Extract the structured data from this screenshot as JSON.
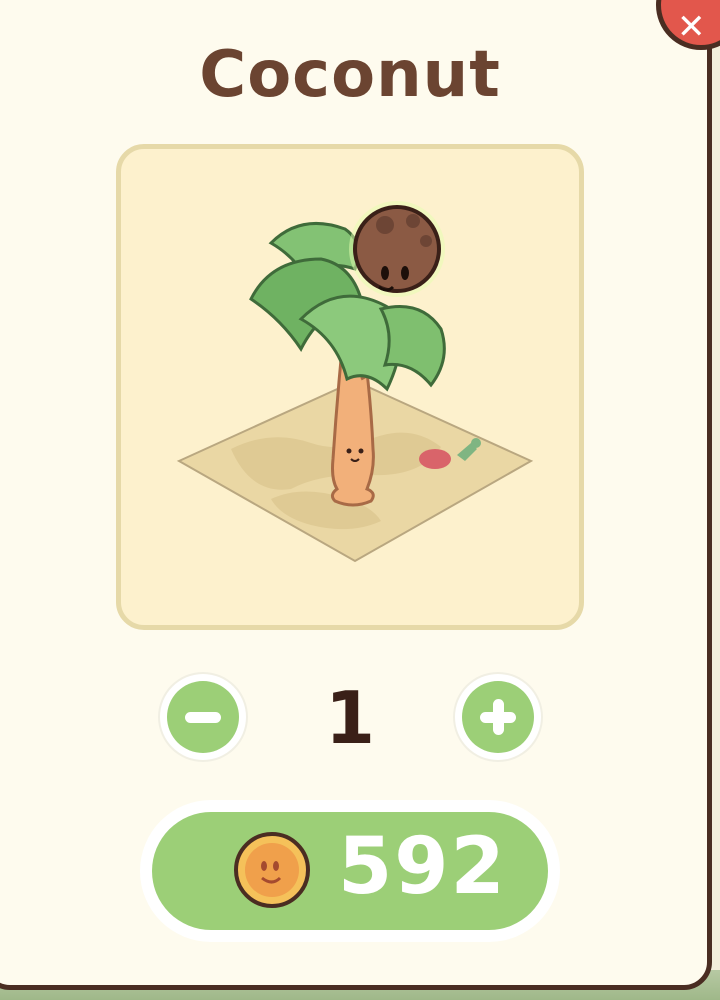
{
  "item": {
    "name": "Coconut"
  },
  "quantity": {
    "value": "1",
    "minus_icon": "minus-icon",
    "plus_icon": "plus-icon"
  },
  "purchase": {
    "price": "592",
    "currency_icon": "coin-icon"
  },
  "colors": {
    "panel_bg": "#fefbee",
    "panel_border": "#4a2d22",
    "title": "#6b4431",
    "card_bg": "#fdf1cd",
    "card_border": "#e6d9a8",
    "button_green": "#9ccf77",
    "close_red": "#e2574c"
  }
}
